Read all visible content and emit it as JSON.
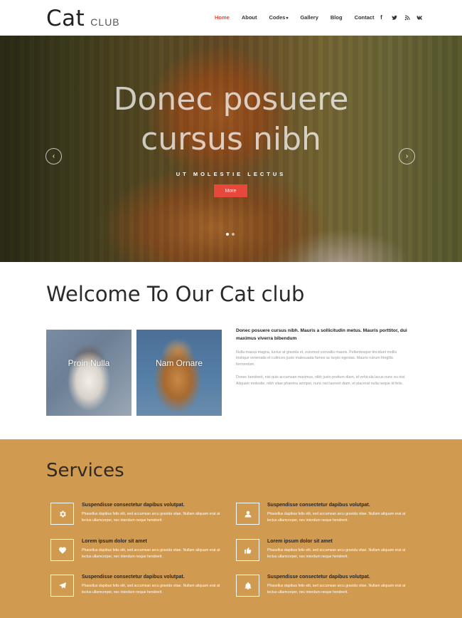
{
  "header": {
    "logo_main": "Cat",
    "logo_sub": "CLUB",
    "nav": [
      "Home",
      "About",
      "Codes",
      "Gallery",
      "Blog",
      "Contact"
    ],
    "active_nav": "Home",
    "social": [
      "facebook-icon",
      "twitter-icon",
      "rss-icon",
      "vk-icon"
    ]
  },
  "hero": {
    "title_line1": "Donec posuere",
    "title_line2": "cursus nibh",
    "subtitle": "UT MOLESTIE LECTUS",
    "button": "More",
    "slides_count": 2,
    "active_slide": 1
  },
  "welcome": {
    "title": "Welcome To Our Cat club",
    "gallery": [
      "Proin Nulla",
      "Nam Ornare"
    ],
    "lead": "Donec posuere cursus nibh. Mauris a sollicitudin metus. Mauris porttitor, dui maximus viverra bibendum",
    "para1": "Nulla massa magna, luctus at gravida et, euismod convallis mauris. Pellentesque tincidunt mollis tristique venenatis et cultrices justo malesuada fames ac turpis egestas. Mauris rutrum fringilla fermentum.",
    "para2": "Donec hendrerit, nisi quis accumsan maximus, nibh justo pretium diam, id vehicula lacus nunc eu nisi. Aliquam molestie, nibh vitae pharetra semper, nunc nisl laoreet diam, et placerat nulla neque id felis."
  },
  "services": {
    "title": "Services",
    "items": [
      {
        "icon": "gear-icon",
        "title": "Suspendisse consectetur dapibus volutpat.",
        "text": "Phasellus dapibus felis elit, sed accumsan arcu gravida vitae. Nullam aliquam erat at lectus ullamcorper, nec interdum neque hendrerit."
      },
      {
        "icon": "user-icon",
        "title": "Suspendisse consectetur dapibus volutpat.",
        "text": "Phasellus dapibus felis elit, sed accumsan arcu gravida vitae. Nullam aliquam erat at lectus ullamcorper, nec interdum neque hendrerit."
      },
      {
        "icon": "heart-icon",
        "title": "Lorem ipsum dolor sit amet",
        "text": "Phasellus dapibus felis elit, sed accumsan arcu gravida vitae. Nullam aliquam erat at lectus ullamcorper, nec interdum neque hendrerit."
      },
      {
        "icon": "thumbs-up-icon",
        "title": "Lorem ipsum dolor sit amet",
        "text": "Phasellus dapibus felis elit, sed accumsan arcu gravida vitae. Nullam aliquam erat at lectus ullamcorper, nec interdum neque hendrerit."
      },
      {
        "icon": "paper-plane-icon",
        "title": "Suspendisse consectetur dapibus volutpat.",
        "text": "Phasellus dapibus felis elit, sed accumsan arcu gravida vitae. Nullam aliquam erat at lectus ullamcorper, nec interdum neque hendrerit."
      },
      {
        "icon": "bell-icon",
        "title": "Suspendisse consectetur dapibus volutpat.",
        "text": "Phasellus dapibus felis elit, sed accumsan arcu gravida vitae. Nullam aliquam erat at lectus ullamcorper, nec interdum neque hendrerit."
      }
    ]
  },
  "colors": {
    "accent": "#e8473c",
    "services_bg": "#d09a51"
  }
}
